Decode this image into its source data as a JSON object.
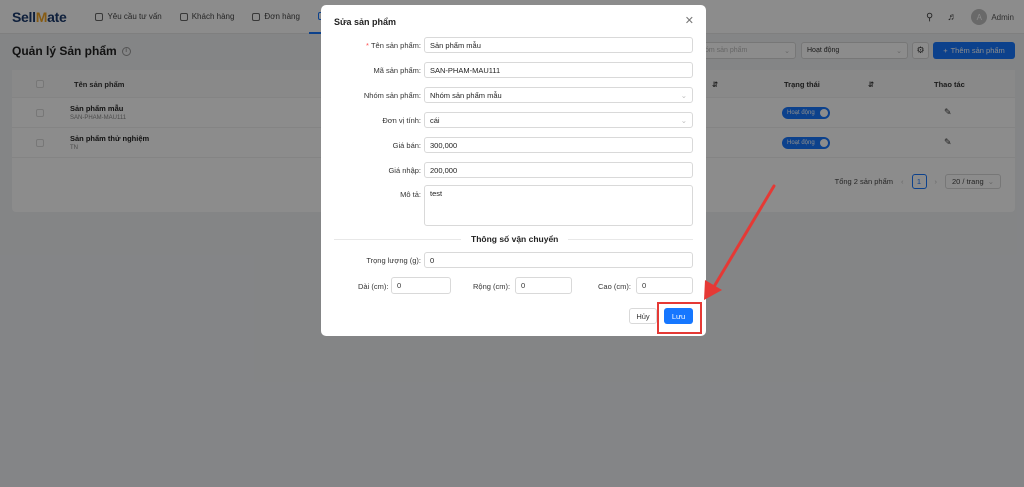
{
  "app": {
    "logo_text_1": "Sell",
    "logo_text_2": "ate",
    "nav": [
      {
        "label": "Yêu cầu tư vấn"
      },
      {
        "label": "Khách hàng"
      },
      {
        "label": "Đơn hàng"
      },
      {
        "label": "Qu"
      }
    ],
    "user": {
      "avatar_letter": "A",
      "name": "Admin"
    }
  },
  "page": {
    "title": "Quản lý Sản phẩm",
    "filter_placeholder": "Nhóm sản phẩm",
    "status_filter": "Hoạt động",
    "add_button": "Thêm sản phẩm"
  },
  "table": {
    "headers": {
      "name": "Tên sản phẩm",
      "status": "Trạng thái",
      "actions": "Thao tác"
    },
    "rows": [
      {
        "name": "Sản phẩm mẫu",
        "code": "SAN-PHAM-MAU111",
        "status": "Hoạt động"
      },
      {
        "name": "Sản phẩm thử nghiệm",
        "code": "TN",
        "status": "Hoạt động"
      }
    ],
    "pagination": {
      "total": "Tổng 2 sản phẩm",
      "current": "1",
      "page_size": "20 / trang"
    }
  },
  "modal": {
    "title": "Sửa sản phẩm",
    "fields": {
      "name_label": "Tên sản phẩm:",
      "name_value": "Sản phẩm mẫu",
      "code_label": "Mã sản phẩm:",
      "code_value": "SAN-PHAM-MAU111",
      "group_label": "Nhóm sản phẩm:",
      "group_value": "Nhóm sản phẩm mẫu",
      "unit_label": "Đơn vị tính:",
      "unit_value": "cái",
      "price_label": "Giá bán:",
      "price_value": "300,000",
      "cost_label": "Giá nhập:",
      "cost_value": "200,000",
      "desc_label": "Mô tả:",
      "desc_value": "test"
    },
    "shipping": {
      "title": "Thông số vận chuyển",
      "weight_label": "Trọng lượng (g):",
      "weight_value": "0",
      "length_label": "Dài (cm):",
      "length_value": "0",
      "width_label": "Rộng (cm):",
      "width_value": "0",
      "height_label": "Cao (cm):",
      "height_value": "0"
    },
    "cancel": "Hủy",
    "save": "Lưu"
  },
  "colors": {
    "primary": "#1677ff",
    "annotation": "#e53935"
  }
}
